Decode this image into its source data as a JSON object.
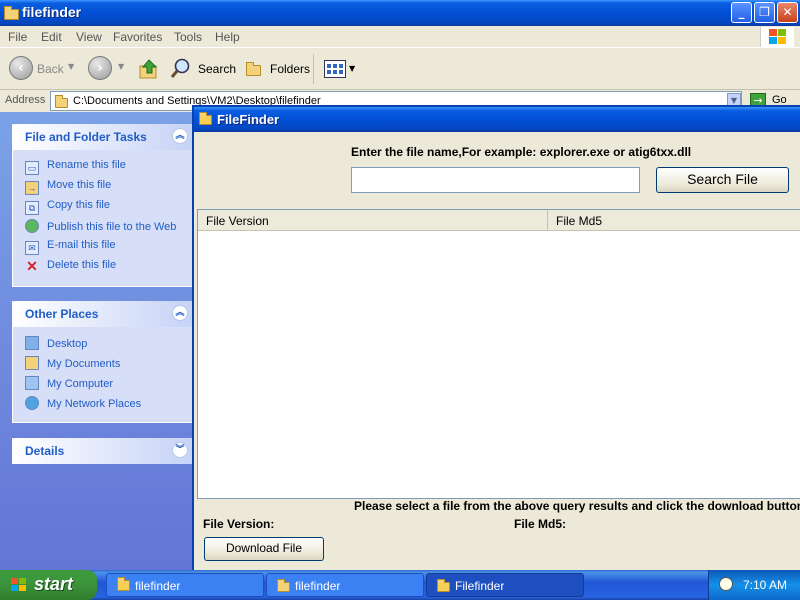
{
  "explorer": {
    "title": "filefinder",
    "menu": [
      "File",
      "Edit",
      "View",
      "Favorites",
      "Tools",
      "Help"
    ],
    "toolbar": {
      "back": "Back",
      "search": "Search",
      "folders": "Folders"
    },
    "address": {
      "label": "Address",
      "value": "C:\\Documents and Settings\\VM2\\Desktop\\filefinder",
      "go": "Go"
    },
    "panels": {
      "file_tasks": {
        "title": "File and Folder Tasks",
        "items": [
          "Rename this file",
          "Move this file",
          "Copy this file",
          "Publish this file to the Web",
          "E-mail this file",
          "Delete this file"
        ]
      },
      "other_places": {
        "title": "Other Places",
        "items": [
          "Desktop",
          "My Documents",
          "My Computer",
          "My Network Places"
        ]
      },
      "details": {
        "title": "Details"
      }
    }
  },
  "filefinder": {
    "title": "FileFinder",
    "prompt": "Enter the file name,For example: explorer.exe or atig6txx.dll",
    "search_value": "",
    "search_button": "Search File",
    "columns": [
      "File Version",
      "File Md5"
    ],
    "instruction": "Please select a file from the above query results and click the download button",
    "file_version_label": "File Version:",
    "file_md5_label": "File Md5:",
    "download_button": "Download File"
  },
  "taskbar": {
    "start": "start",
    "tasks": [
      "filefinder",
      "filefinder",
      "Filefinder"
    ],
    "clock": "7:10 AM"
  },
  "colors": {
    "xp_blue": "#0350d6",
    "task_link": "#215dc6",
    "start_green": "#3d963d"
  }
}
